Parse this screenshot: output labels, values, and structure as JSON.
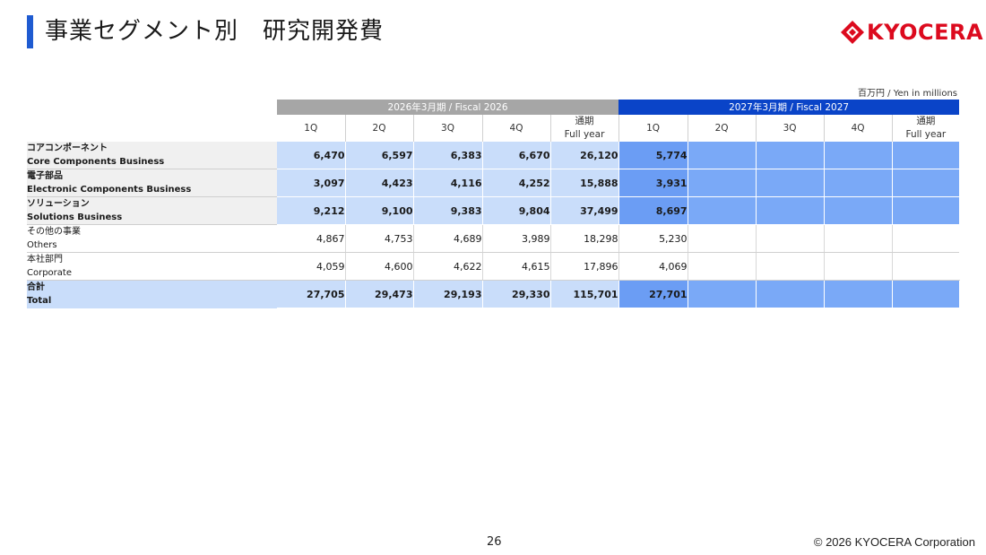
{
  "header": {
    "title": "事業セグメント別　研究開発費",
    "logo_text": "KYOCERA",
    "logo_color": "#dc0a1e",
    "accent_color": "#1f5bd1"
  },
  "table": {
    "unit_note": "百万円 / Yen in millions",
    "fiscal_prev": "2026年3月期 / Fiscal 2026",
    "fiscal_cur": "2027年3月期 / Fiscal 2027",
    "columns": [
      "1Q",
      "2Q",
      "3Q",
      "4Q",
      "通期",
      "Full year"
    ],
    "rows": [
      {
        "ja": "コアコンポーネント",
        "en": "Core Components Business",
        "prev": [
          "6,470",
          "6,597",
          "6,383",
          "6,670",
          "26,120"
        ],
        "cur": [
          "5,774",
          "",
          "",
          "",
          ""
        ]
      },
      {
        "ja": "電子部品",
        "en": "Electronic Components Business",
        "prev": [
          "3,097",
          "4,423",
          "4,116",
          "4,252",
          "15,888"
        ],
        "cur": [
          "3,931",
          "",
          "",
          "",
          ""
        ]
      },
      {
        "ja": "ソリューション",
        "en": "Solutions Business",
        "prev": [
          "9,212",
          "9,100",
          "9,383",
          "9,804",
          "37,499"
        ],
        "cur": [
          "8,697",
          "",
          "",
          "",
          ""
        ]
      },
      {
        "ja": "その他の事業",
        "en": "Others",
        "prev": [
          "4,867",
          "4,753",
          "4,689",
          "3,989",
          "18,298"
        ],
        "cur": [
          "5,230",
          "",
          "",
          "",
          ""
        ]
      },
      {
        "ja": "本社部門",
        "en": "Corporate",
        "prev": [
          "4,059",
          "4,600",
          "4,622",
          "4,615",
          "17,896"
        ],
        "cur": [
          "4,069",
          "",
          "",
          "",
          ""
        ]
      },
      {
        "ja": "合計",
        "en": "Total",
        "prev": [
          "27,705",
          "29,473",
          "29,193",
          "29,330",
          "115,701"
        ],
        "cur": [
          "27,701",
          "",
          "",
          "",
          ""
        ]
      }
    ]
  },
  "footer": {
    "page_number": "26",
    "copyright": "© 2026 KYOCERA Corporation"
  }
}
